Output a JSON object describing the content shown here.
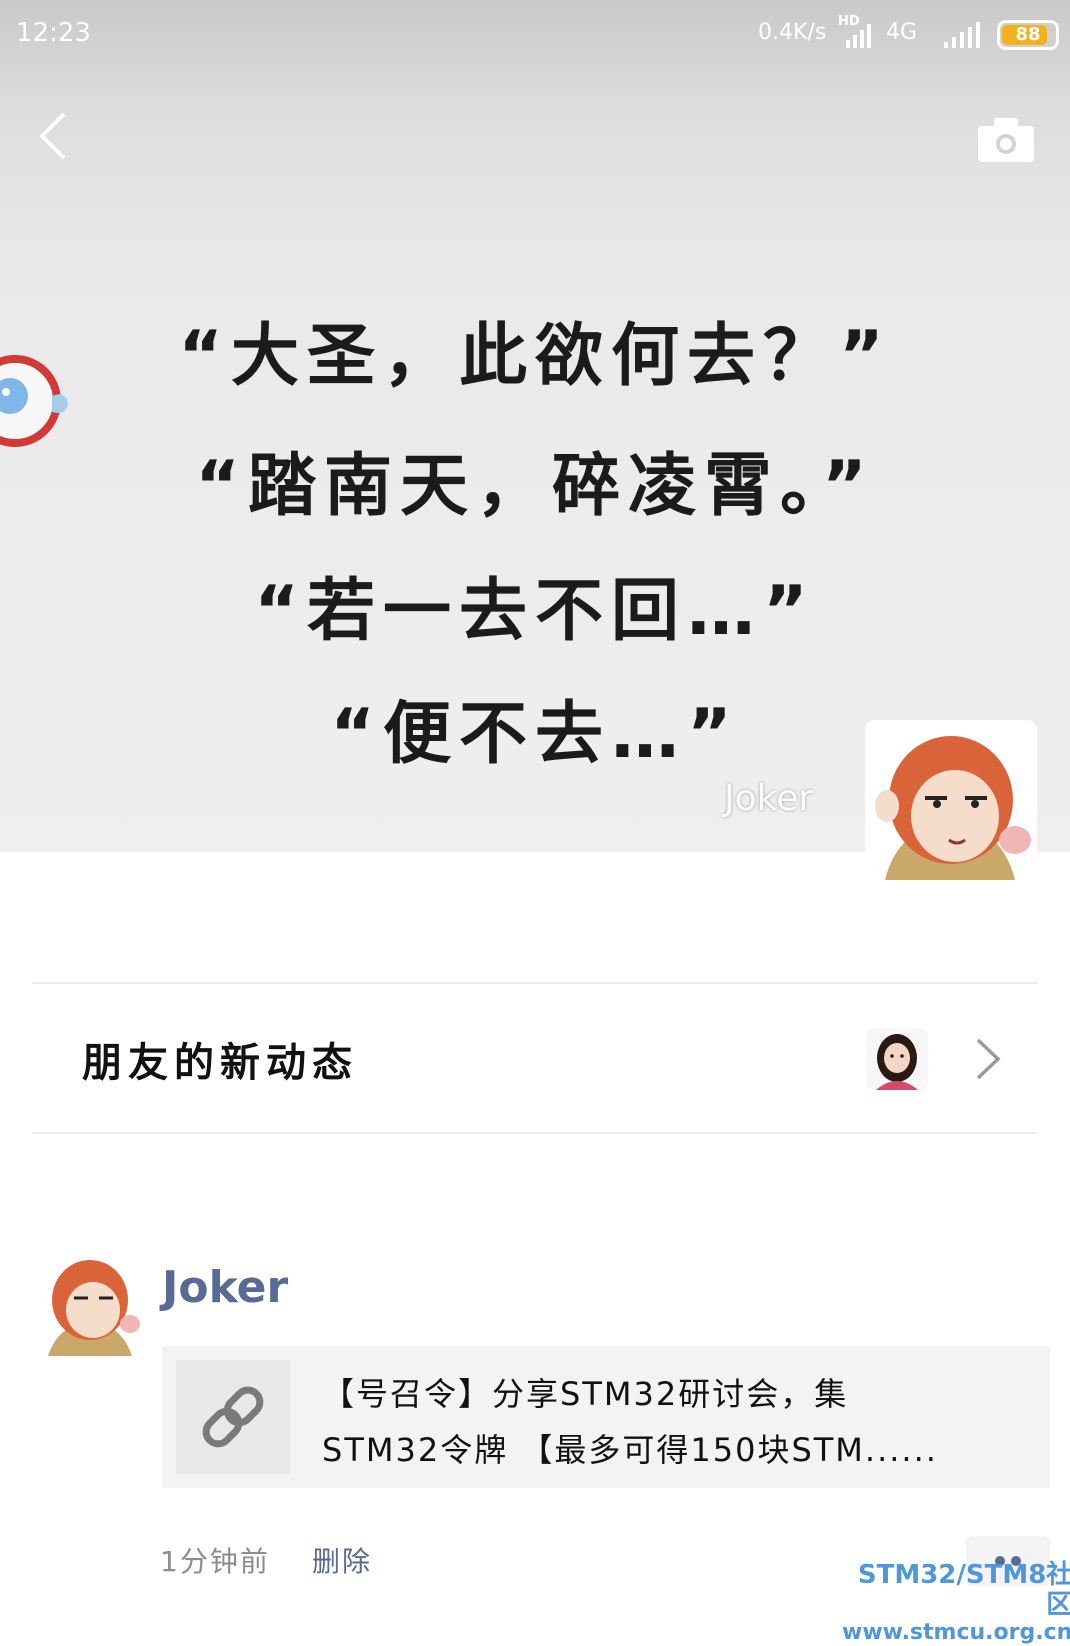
{
  "status_bar": {
    "time": "12:23",
    "network_speed": "0.4K/s",
    "hd_label": "HD",
    "network_type": "4G",
    "battery_level": "88",
    "battery_fraction": 0.88,
    "battery_color": "#f2b21e"
  },
  "header": {
    "back_icon": "chevron-left-icon",
    "camera_icon": "camera-icon"
  },
  "cover": {
    "lines": [
      "“大圣，此欲何去？”",
      "“踏南天，碎凌霄。”",
      "“若一去不回…”",
      "“便不去…”"
    ],
    "watermark": "Joker"
  },
  "friends": {
    "title": "朋友的新动态"
  },
  "post": {
    "author": "Joker",
    "author_color": "#576b95",
    "link_lines": [
      "【号召令】分享STM32研讨会，集",
      "STM32令牌 【最多可得150块STM......"
    ],
    "time": "1分钟前",
    "delete_label": "删除"
  },
  "site_watermark": {
    "line1": "STM32/STM8社区",
    "line2": "www.stmcu.org.cn"
  }
}
